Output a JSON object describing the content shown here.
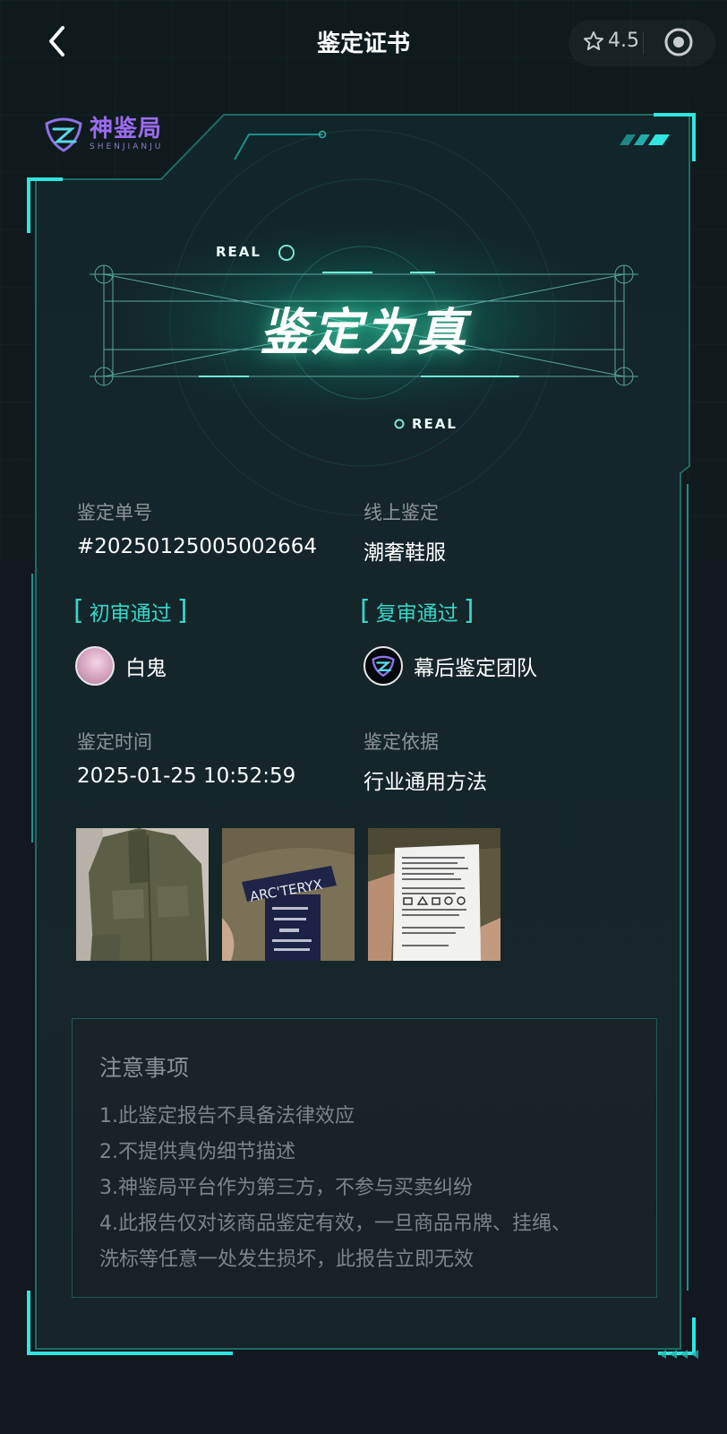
{
  "nav": {
    "title": "鉴定证书",
    "rating": "4.5"
  },
  "logo": {
    "cn": "神鉴局",
    "en": "SHENJIANJU"
  },
  "verdict": {
    "text": "鉴定为真",
    "tag_top": "REAL",
    "tag_bottom": "REAL"
  },
  "info": {
    "order_label": "鉴定单号",
    "order_value": "#20250125005002664",
    "mode_label": "线上鉴定",
    "mode_value": "潮奢鞋服",
    "first_review": "初审通过",
    "second_review": "复审通过",
    "first_reviewer": "白鬼",
    "second_reviewer": "幕后鉴定团队",
    "time_label": "鉴定时间",
    "time_value": "2025-01-25 10:52:59",
    "basis_label": "鉴定依据",
    "basis_value": "行业通用方法"
  },
  "photos": [
    {
      "name": "jacket-photo",
      "label": ""
    },
    {
      "name": "neck-label-photo",
      "label": "ARC'TERYX"
    },
    {
      "name": "care-label-photo",
      "label": ""
    }
  ],
  "notice": {
    "title": "注意事项",
    "items": [
      "1.此鉴定报告不具备法律效应",
      "2.不提供真伪细节描述",
      "3.神鉴局平台作为第三方，不参与买卖纠纷",
      "4.此报告仅对该商品鉴定有效，一旦商品吊牌、挂绳、",
      "洗标等任意一处发生损坏，此报告立即无效"
    ]
  },
  "colors": {
    "accent": "#37d6c8",
    "card_bg": "#17252a",
    "page_bg": "#121720",
    "logo": "#9b6cf0"
  }
}
